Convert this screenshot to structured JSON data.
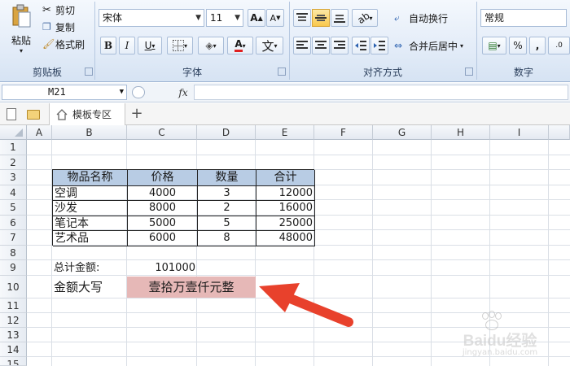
{
  "ribbon": {
    "clipboard": {
      "paste_label": "粘贴",
      "cut_label": "剪切",
      "copy_label": "复制",
      "format_painter_label": "格式刷",
      "group_label": "剪贴板"
    },
    "font": {
      "font_name": "宋体",
      "font_size": "11",
      "bold": "B",
      "italic": "I",
      "underline": "U",
      "font_color_letter": "A",
      "phonetic_label": "文",
      "group_label": "字体"
    },
    "alignment": {
      "wrap_text_label": "自动换行",
      "merge_center_label": "合并后居中",
      "group_label": "对齐方式"
    },
    "number": {
      "format_value": "常规",
      "percent": "%",
      "comma": ",",
      "group_label": "数字"
    }
  },
  "formula_bar": {
    "name_box": "M21",
    "fx": "fx",
    "formula": ""
  },
  "tabs": {
    "template_tab_label": "模板专区",
    "add_tab": "+"
  },
  "columns": [
    "A",
    "B",
    "C",
    "D",
    "E",
    "F",
    "G",
    "H",
    "I"
  ],
  "rows": [
    "1",
    "2",
    "3",
    "4",
    "5",
    "6",
    "7",
    "8",
    "9",
    "10",
    "11",
    "12",
    "13",
    "14",
    "15"
  ],
  "table": {
    "headers": [
      "物品名称",
      "价格",
      "数量",
      "合计"
    ],
    "rows": [
      [
        "空调",
        "4000",
        "3",
        "12000"
      ],
      [
        "沙发",
        "8000",
        "2",
        "16000"
      ],
      [
        "笔记本",
        "5000",
        "5",
        "25000"
      ],
      [
        "艺术品",
        "6000",
        "8",
        "48000"
      ]
    ]
  },
  "summary": {
    "total_label": "总计金额:",
    "total_value": "101000",
    "uppercase_label": "金额大写",
    "uppercase_value": "壹拾万壹仟元整"
  },
  "watermark": {
    "brand": "Baidu经验",
    "url": "jingyan.baidu.com"
  },
  "colors": {
    "table_header_fill": "#b8cce4",
    "highlight_fill": "#e6b8b7",
    "arrow": "#e8412c",
    "ribbon_bg": "#dfe9f5"
  }
}
